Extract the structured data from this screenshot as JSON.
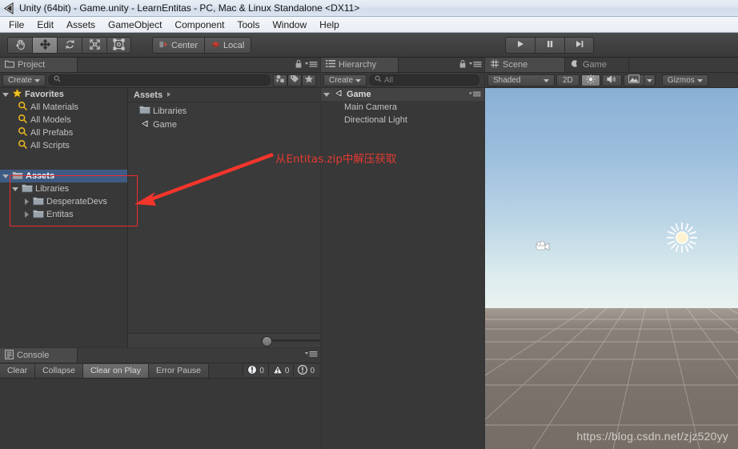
{
  "window": {
    "title": "Unity (64bit) - Game.unity - LearnEntitas - PC, Mac & Linux Standalone <DX11>",
    "icon": "unity-logo-icon"
  },
  "menubar": {
    "items": [
      "File",
      "Edit",
      "Assets",
      "GameObject",
      "Component",
      "Tools",
      "Window",
      "Help"
    ]
  },
  "toolbar": {
    "tools": [
      {
        "name": "hand-tool",
        "icon": "hand-icon",
        "active": false
      },
      {
        "name": "move-tool",
        "icon": "move-icon",
        "active": true
      },
      {
        "name": "rotate-tool",
        "icon": "rotate-icon",
        "active": false
      },
      {
        "name": "scale-tool",
        "icon": "scale-icon",
        "active": false
      },
      {
        "name": "rect-tool",
        "icon": "rect-transform-icon",
        "active": false
      }
    ],
    "pivot_label": "Center",
    "pivot_icon": "pivot-center-icon",
    "space_label": "Local",
    "space_icon": "space-local-icon",
    "play_label": "play-button",
    "pause_label": "pause-button",
    "step_label": "step-button"
  },
  "project_panel": {
    "tab_label": "Project",
    "tab_icon": "project-folder-icon",
    "lock_icon": "lock-icon",
    "menu_icon": "panel-menu-icon",
    "create_label": "Create",
    "search_placeholder": "",
    "search_value": "",
    "search_icon": "search-icon",
    "filter_type_icon": "filter-by-type-icon",
    "filter_label_icon": "filter-by-label-icon",
    "favorite_icon": "favorite-star-icon",
    "favorites_header": "Favorites",
    "favorites": [
      "All Materials",
      "All Models",
      "All Prefabs",
      "All Scripts"
    ],
    "assets_root": "Assets",
    "tree": [
      {
        "label": "Libraries",
        "depth": 1,
        "expanded": true
      },
      {
        "label": "DesperateDevs",
        "depth": 2,
        "expanded": false
      },
      {
        "label": "Entitas",
        "depth": 2,
        "expanded": false
      }
    ],
    "breadcrumb": "Assets",
    "breadcrumb_arrow": "chevron-right-icon",
    "assets_items": [
      {
        "label": "Libraries",
        "icon": "folder-icon"
      },
      {
        "label": "Game",
        "icon": "unity-scene-icon"
      }
    ]
  },
  "hierarchy_panel": {
    "tab_label": "Hierarchy",
    "tab_icon": "hierarchy-icon",
    "lock_icon": "lock-icon",
    "menu_icon": "panel-menu-icon",
    "create_label": "Create",
    "search_placeholder": "All",
    "search_value": "",
    "search_icon": "search-icon",
    "scene_name": "Game",
    "scene_icon": "unity-scene-icon",
    "objects": [
      "Main Camera",
      "Directional Light"
    ]
  },
  "scene_panel": {
    "tabs": [
      {
        "label": "Scene",
        "icon": "scene-grid-icon",
        "active": true
      },
      {
        "label": "Game",
        "icon": "game-moon-icon",
        "active": false
      }
    ],
    "draw_mode": "Shaded",
    "view_2d_label": "2D",
    "lighting_icon": "lighting-sun-icon",
    "audio_icon": "audio-speaker-icon",
    "effects_icon": "effects-image-icon",
    "gizmos_label": "Gizmos",
    "watermark": "https://blog.csdn.net/zjz520yy",
    "gizmos_in_scene": [
      {
        "name": "camera-gizmo",
        "icon": "camera-icon"
      },
      {
        "name": "directional-light-gizmo",
        "icon": "sun-icon"
      }
    ]
  },
  "console_panel": {
    "tab_label": "Console",
    "tab_icon": "console-icon",
    "menu_icon": "panel-menu-icon",
    "buttons": [
      {
        "label": "Clear",
        "name": "clear-button",
        "active": false
      },
      {
        "label": "Collapse",
        "name": "collapse-button",
        "active": false
      },
      {
        "label": "Clear on Play",
        "name": "clear-on-play-button",
        "active": true
      },
      {
        "label": "Error Pause",
        "name": "error-pause-button",
        "active": false
      }
    ],
    "counters": [
      {
        "name": "error-count",
        "icon": "error-icon",
        "value": "0"
      },
      {
        "name": "warning-count",
        "icon": "warning-icon",
        "value": "0"
      },
      {
        "name": "info-count",
        "icon": "info-icon",
        "value": "0"
      }
    ]
  },
  "annotation": {
    "text": "从Entitas.zip中解压获取",
    "color": "#e23b32"
  }
}
